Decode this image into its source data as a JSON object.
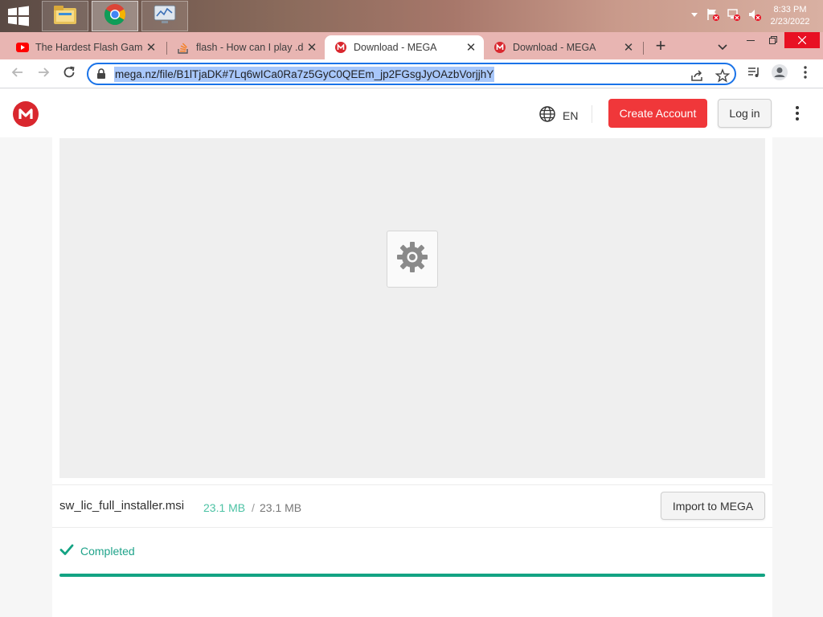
{
  "taskbar": {
    "apps": [
      {
        "name": "file-explorer"
      },
      {
        "name": "google-chrome",
        "active": true
      },
      {
        "name": "performance-monitor"
      }
    ],
    "clock": {
      "time": "8:33 PM",
      "date": "2/23/2022"
    }
  },
  "browser": {
    "tabs": [
      {
        "title": "The Hardest Flash Game",
        "favicon": "youtube-icon",
        "active": false
      },
      {
        "title": "flash - How can I play .dc",
        "favicon": "stackoverflow-icon",
        "active": false
      },
      {
        "title": "Download - MEGA",
        "favicon": "mega-icon",
        "active": true
      },
      {
        "title": "Download - MEGA",
        "favicon": "mega-icon",
        "active": false
      }
    ],
    "new_tab_label": "+",
    "url": "mega.nz/file/B1lTjaDK#7Lq6wICa0Ra7z5GyC0QEEm_jp2FGsgJyOAzbVorjjhY"
  },
  "mega": {
    "language": "EN",
    "create_account_label": "Create Account",
    "login_label": "Log in",
    "file": {
      "name": "sw_lic_full_installer.msi",
      "downloaded": "23.1 MB",
      "separator": "/",
      "total": "23.1 MB"
    },
    "import_label": "Import to MEGA",
    "status": "Completed",
    "progress": 1.0,
    "colors": {
      "brand_red": "#d9272e",
      "create_button": "#f0373a",
      "success_green": "#13a383"
    }
  }
}
